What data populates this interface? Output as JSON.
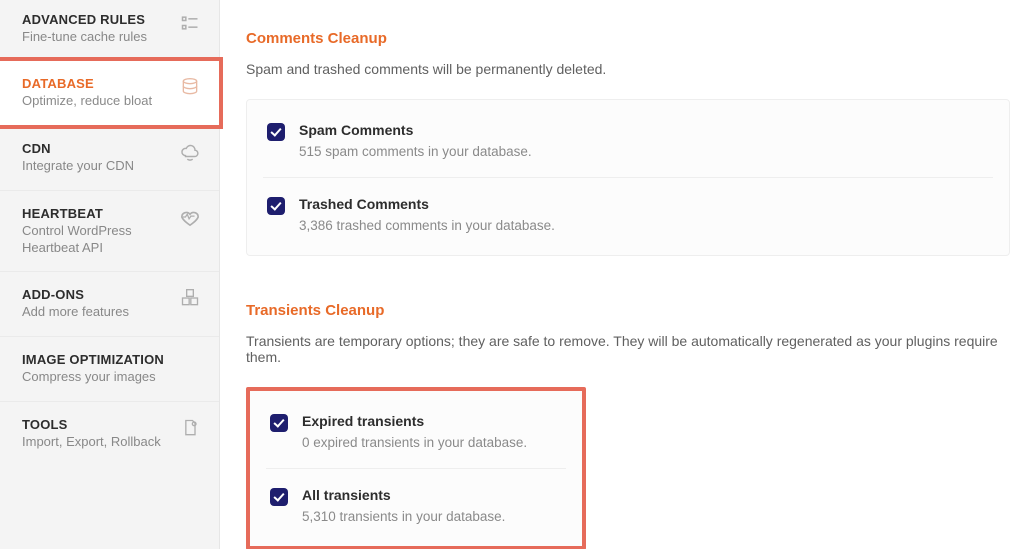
{
  "sidebar": {
    "items": [
      {
        "title": "ADVANCED RULES",
        "sub": "Fine-tune cache rules"
      },
      {
        "title": "DATABASE",
        "sub": "Optimize, reduce bloat"
      },
      {
        "title": "CDN",
        "sub": "Integrate your CDN"
      },
      {
        "title": "HEARTBEAT",
        "sub": "Control WordPress Heartbeat API"
      },
      {
        "title": "ADD-ONS",
        "sub": "Add more features"
      },
      {
        "title": "IMAGE OPTIMIZATION",
        "sub": "Compress your images"
      },
      {
        "title": "TOOLS",
        "sub": "Import, Export, Rollback"
      }
    ]
  },
  "sections": {
    "comments": {
      "title": "Comments Cleanup",
      "desc": "Spam and trashed comments will be permanently deleted.",
      "opts": [
        {
          "label": "Spam Comments",
          "sub": "515 spam comments in your database."
        },
        {
          "label": "Trashed Comments",
          "sub": "3,386 trashed comments in your database."
        }
      ]
    },
    "transients": {
      "title": "Transients Cleanup",
      "desc": "Transients are temporary options; they are safe to remove. They will be automatically regenerated as your plugins require them.",
      "opts": [
        {
          "label": "Expired transients",
          "sub": "0 expired transients in your database."
        },
        {
          "label": "All transients",
          "sub": "5,310 transients in your database."
        }
      ]
    }
  }
}
